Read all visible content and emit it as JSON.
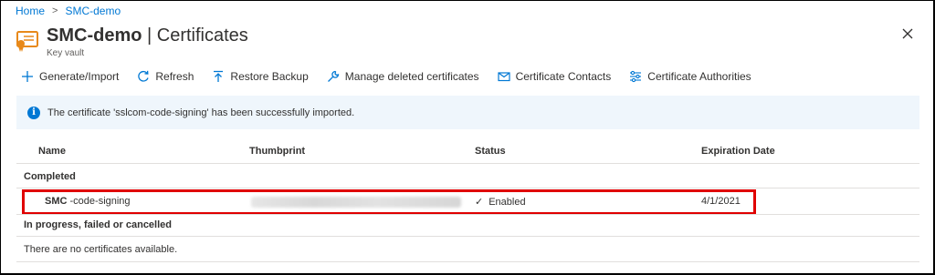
{
  "breadcrumb": {
    "home": "Home",
    "separator": ">",
    "current": "SMC-demo"
  },
  "header": {
    "title_bold": "SMC-demo",
    "title_rest": " | Certificates",
    "subtitle": "Key vault"
  },
  "toolbar": {
    "generate": "Generate/Import",
    "refresh": "Refresh",
    "restore": "Restore Backup",
    "manage_deleted": "Manage deleted certificates",
    "contacts": "Certificate Contacts",
    "authorities": "Certificate Authorities"
  },
  "banner": {
    "icon": "i",
    "text": "The certificate 'sslcom-code-signing' has been successfully imported."
  },
  "table": {
    "columns": [
      "Name",
      "Thumbprint",
      "Status",
      "Expiration Date"
    ],
    "groups": {
      "completed": "Completed",
      "in_progress": "In progress, failed or cancelled"
    },
    "row": {
      "name_bold": "SMC",
      "name_rest": " -code-signing",
      "status_icon": "✓",
      "status": "Enabled",
      "expiration": "4/1/2021"
    },
    "empty": "There are no certificates available."
  },
  "colors": {
    "accent": "#0078d4",
    "highlight": "#e00000",
    "banner_bg": "#eff6fc"
  }
}
